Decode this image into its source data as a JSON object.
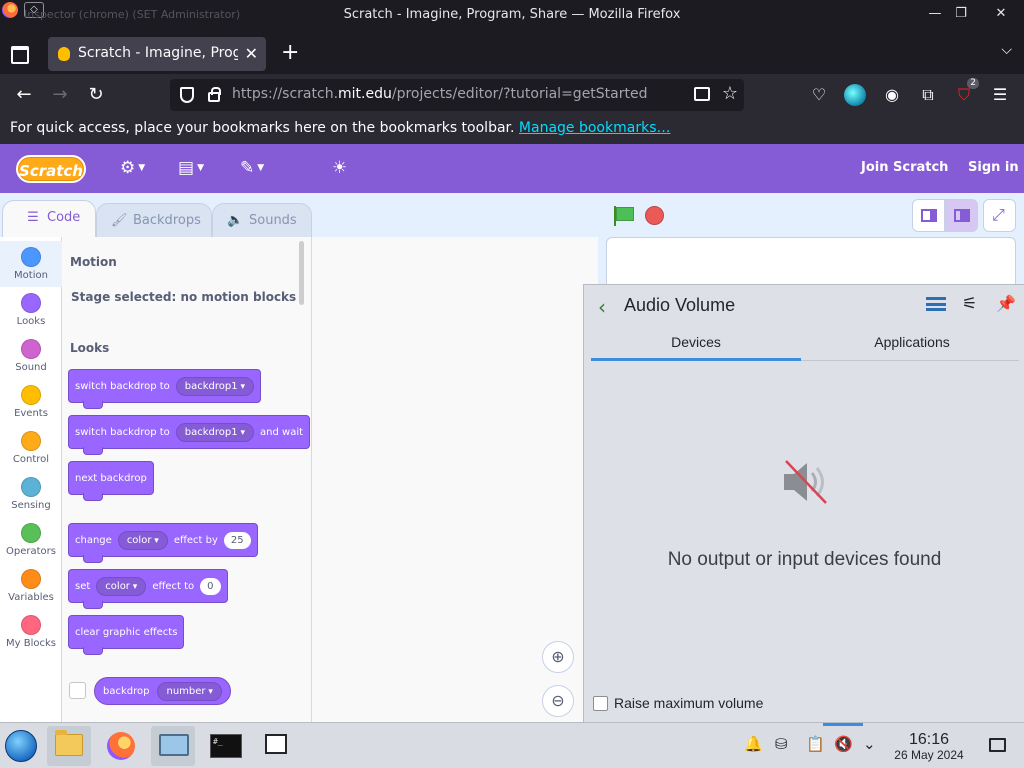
{
  "window": {
    "title": "Scratch - Imagine, Program, Share — Mozilla Firefox",
    "ghost_title": "Inspector (chrome) (SET Administrator)"
  },
  "browser": {
    "tab_title": "Scratch - Imagine, Program, Share",
    "url_prefix": "https://scratch.",
    "url_domain": "mit.edu",
    "url_path": "/projects/editor/?tutorial=getStarted",
    "extension_badge": "2",
    "bookmarks_message": "For quick access, place your bookmarks here on the bookmarks toolbar.",
    "manage_bookmarks": "Manage bookmarks…"
  },
  "scratch": {
    "logo": "Scratch",
    "join": "Join Scratch",
    "signin": "Sign in",
    "tabs": [
      "Code",
      "Backdrops",
      "Sounds"
    ],
    "categories": [
      {
        "label": "Motion",
        "color": "#4c97ff"
      },
      {
        "label": "Looks",
        "color": "#9966ff"
      },
      {
        "label": "Sound",
        "color": "#cf63cf"
      },
      {
        "label": "Events",
        "color": "#ffbf00"
      },
      {
        "label": "Control",
        "color": "#ffab19"
      },
      {
        "label": "Sensing",
        "color": "#5cb1d6"
      },
      {
        "label": "Operators",
        "color": "#59c059"
      },
      {
        "label": "Variables",
        "color": "#ff8c1a"
      },
      {
        "label": "My Blocks",
        "color": "#ff6680"
      }
    ],
    "palette": {
      "motion_heading": "Motion",
      "motion_note": "Stage selected: no motion blocks",
      "looks_heading": "Looks",
      "b1_text": "switch backdrop to",
      "b1_dd": "backdrop1",
      "b2_text": "switch backdrop to",
      "b2_dd": "backdrop1",
      "b2_tail": "and wait",
      "b3_text": "next backdrop",
      "b4_text": "change",
      "b4_dd": "color",
      "b4_mid": "effect by",
      "b4_num": "25",
      "b5_text": "set",
      "b5_dd": "color",
      "b5_mid": "effect to",
      "b5_num": "0",
      "b6_text": "clear graphic effects",
      "r1_text": "backdrop",
      "r1_dd": "number"
    }
  },
  "audio": {
    "title": "Audio Volume",
    "tabs": [
      "Devices",
      "Applications"
    ],
    "empty_message": "No output or input devices found",
    "raise_label": "Raise maximum volume"
  },
  "taskbar": {
    "time": "16:16",
    "date": "26 May 2024"
  }
}
